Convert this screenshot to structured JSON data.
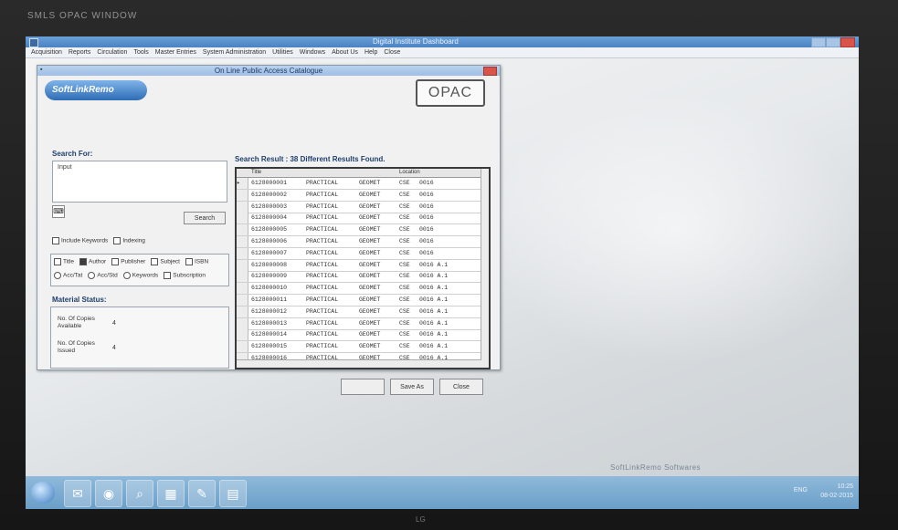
{
  "bezel_text": "SMLS OPAC WINDOW",
  "app": {
    "title": "Digital Institute Dashboard",
    "menu": [
      "Acquisition",
      "Reports",
      "Circulation",
      "Tools",
      "Master Entries",
      "System Administration",
      "Utilities",
      "Windows",
      "About Us",
      "Help",
      "Close"
    ]
  },
  "opac": {
    "window_title": "On Line Public Access Catalogue",
    "logo_text": "SoftLinkRemo",
    "badge_text": "OPAC",
    "search_for_label": "Search For:",
    "search_value": "Input",
    "search_button": "Search",
    "options": [
      {
        "label": "Include Keywords",
        "checked": false
      },
      {
        "label": "Indexing",
        "checked": false
      }
    ],
    "fields_row1": [
      {
        "label": "Title",
        "checked": false
      },
      {
        "label": "Author",
        "checked": true
      },
      {
        "label": "Publisher",
        "checked": false
      },
      {
        "label": "Subject",
        "checked": false
      },
      {
        "label": "ISBN",
        "checked": false
      }
    ],
    "fields_row2": [
      {
        "label": "Acc/Tat",
        "checked": false
      },
      {
        "label": "Acc/Std",
        "checked": false
      },
      {
        "label": "Keywords",
        "checked": false
      },
      {
        "label": "Subscription",
        "checked": false
      }
    ],
    "material_status_label": "Material Status:",
    "copies_available_label": "No. Of Copies Available",
    "copies_available_value": "4",
    "copies_issued_label": "No. Of Copies Issued",
    "copies_issued_value": "4",
    "results_heading": "Search Result : 38 Different Results Found.",
    "grid_headers": [
      "Title",
      "",
      "",
      "Location",
      ""
    ],
    "grid_rows": [
      [
        "6128000001",
        "PRACTICAL",
        "GEOMET",
        "CSE",
        "0016"
      ],
      [
        "6128000002",
        "PRACTICAL",
        "GEOMET",
        "CSE",
        "0016"
      ],
      [
        "6128000003",
        "PRACTICAL",
        "GEOMET",
        "CSE",
        "0016"
      ],
      [
        "6128000004",
        "PRACTICAL",
        "GEOMET",
        "CSE",
        "0016"
      ],
      [
        "6128000005",
        "PRACTICAL",
        "GEOMET",
        "CSE",
        "0016"
      ],
      [
        "6128000006",
        "PRACTICAL",
        "GEOMET",
        "CSE",
        "0016"
      ],
      [
        "6128000007",
        "PRACTICAL",
        "GEOMET",
        "CSE",
        "0016"
      ],
      [
        "6128000008",
        "PRACTICAL",
        "GEOMET",
        "CSE",
        "0016 A.1"
      ],
      [
        "6128000009",
        "PRACTICAL",
        "GEOMET",
        "CSE",
        "0016 A.1"
      ],
      [
        "6128000010",
        "PRACTICAL",
        "GEOMET",
        "CSE",
        "0016 A.1"
      ],
      [
        "6128000011",
        "PRACTICAL",
        "GEOMET",
        "CSE",
        "0016 A.1"
      ],
      [
        "6128000012",
        "PRACTICAL",
        "GEOMET",
        "CSE",
        "0016 A.1"
      ],
      [
        "6128000013",
        "PRACTICAL",
        "GEOMET",
        "CSE",
        "0016 A.1"
      ],
      [
        "6128000014",
        "PRACTICAL",
        "GEOMET",
        "CSE",
        "0016 A.1"
      ],
      [
        "6128000015",
        "PRACTICAL",
        "GEOMET",
        "CSE",
        "0016 A.1"
      ],
      [
        "6128000016",
        "PRACTICAL",
        "GEOMET",
        "CSE",
        "0016 A.1"
      ]
    ],
    "bottom_buttons": [
      "",
      "Save As",
      "Close"
    ]
  },
  "desktop_watermark": "SoftLinkRemo  Softwares",
  "taskbar": {
    "icons": [
      "ie-icon",
      "mail-icon",
      "chrome-icon",
      "search-icon",
      "store-icon",
      "outlook-icon",
      "explorer-icon"
    ],
    "lang": "ENG",
    "time": "10:25",
    "date": "08-02-2015"
  },
  "monitor_brand": "LG"
}
